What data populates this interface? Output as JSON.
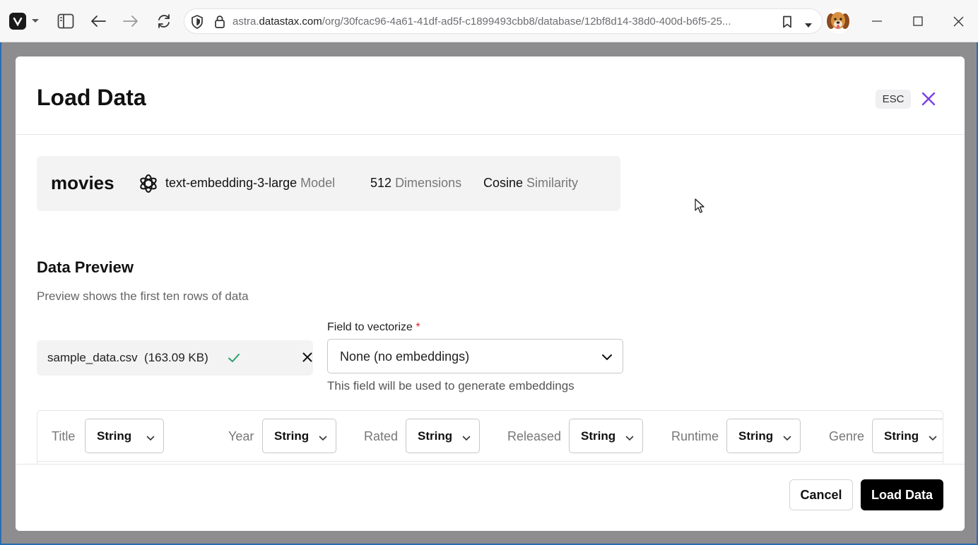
{
  "browser": {
    "url_prefix": "astra.",
    "url_host": "datastax.com",
    "url_path": "/org/30fcac96-4a61-41df-ad5f-c1899493cbb8/database/12bf8d14-38d0-400d-b6f5-25..."
  },
  "modal": {
    "title": "Load Data",
    "esc_label": "ESC"
  },
  "collection": {
    "name": "movies",
    "model_value": "text-embedding-3-large",
    "model_label": "Model",
    "dimensions_value": "512",
    "dimensions_label": "Dimensions",
    "similarity_value": "Cosine",
    "similarity_label": "Similarity"
  },
  "preview": {
    "title": "Data Preview",
    "subtitle": "Preview shows the first ten rows of data"
  },
  "file": {
    "name": "sample_data.csv",
    "size": "(163.09 KB)"
  },
  "vectorize": {
    "label": "Field to vectorize",
    "required_mark": "*",
    "selected": "None (no embeddings)",
    "help": "This field will be used to generate embeddings"
  },
  "columns": [
    {
      "name": "Title",
      "type": "String"
    },
    {
      "name": "Year",
      "type": "String"
    },
    {
      "name": "Rated",
      "type": "String"
    },
    {
      "name": "Released",
      "type": "String"
    },
    {
      "name": "Runtime",
      "type": "String"
    },
    {
      "name": "Genre",
      "type": "String"
    }
  ],
  "footer": {
    "cancel_label": "Cancel",
    "load_label": "Load Data"
  },
  "colors": {
    "accent_close": "#7b3fe4",
    "success_check": "#2e9e6b",
    "primary_button": "#000000"
  }
}
